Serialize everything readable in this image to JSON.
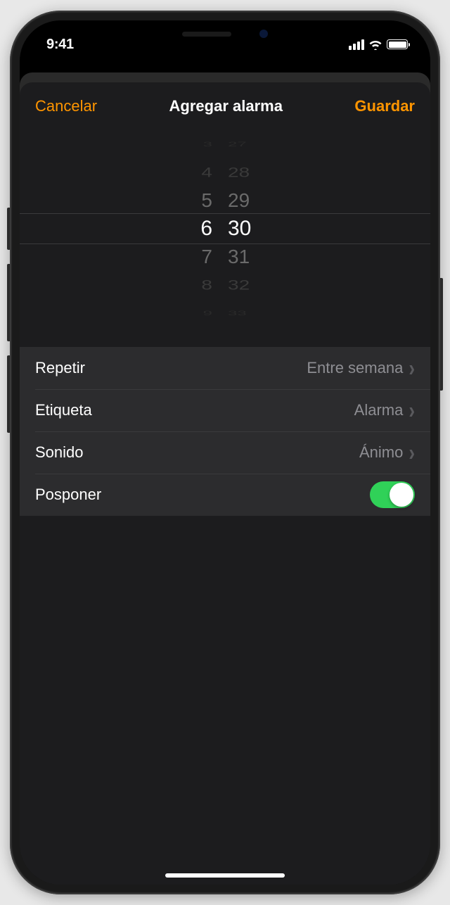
{
  "status": {
    "time": "9:41"
  },
  "nav": {
    "cancel": "Cancelar",
    "title": "Agregar alarma",
    "save": "Guardar"
  },
  "picker": {
    "hours": [
      "3",
      "4",
      "5",
      "6",
      "7",
      "8",
      "9"
    ],
    "minutes": [
      "27",
      "28",
      "29",
      "30",
      "31",
      "32",
      "33"
    ],
    "selected_hour": "6",
    "selected_minute": "30"
  },
  "settings": {
    "repeat": {
      "label": "Repetir",
      "value": "Entre semana"
    },
    "label": {
      "label": "Etiqueta",
      "value": "Alarma"
    },
    "sound": {
      "label": "Sonido",
      "value": "Ánimo"
    },
    "snooze": {
      "label": "Posponer",
      "on": true
    }
  },
  "colors": {
    "accent": "#ff9500",
    "toggle_on": "#30D158"
  }
}
